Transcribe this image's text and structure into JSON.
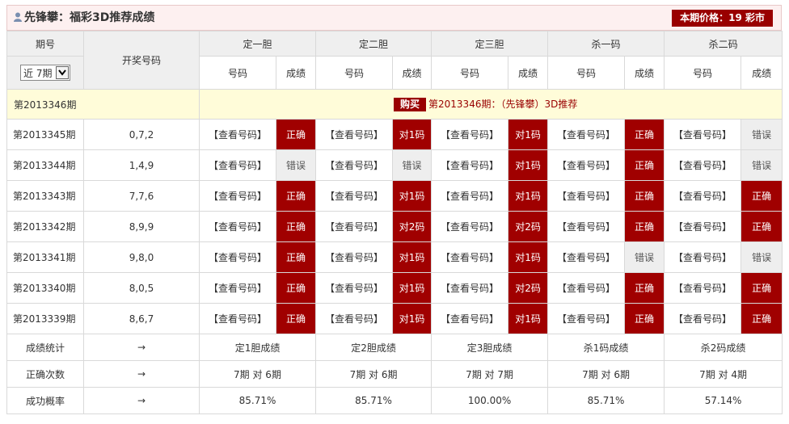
{
  "header": {
    "title": "先锋攀：福彩3D推荐成绩",
    "price": "本期价格：19 彩市"
  },
  "columns": {
    "period": "期号",
    "draw": "开奖号码",
    "groups": [
      "定一胆",
      "定二胆",
      "定三胆",
      "杀一码",
      "杀二码"
    ],
    "sub_code": "号码",
    "sub_result": "成绩"
  },
  "filter": {
    "selected": "近 7期"
  },
  "current": {
    "period": "第2013346期",
    "buy_label": "购买",
    "text": "第2013346期：（先锋攀）3D推荐"
  },
  "view_label": "【查看号码】",
  "rows": [
    {
      "period": "第2013345期",
      "draw": "0,7,2",
      "results": [
        "正确",
        "对1码",
        "对1码",
        "正确",
        "错误"
      ]
    },
    {
      "period": "第2013344期",
      "draw": "1,4,9",
      "results": [
        "错误",
        "错误",
        "对1码",
        "正确",
        "错误"
      ]
    },
    {
      "period": "第2013343期",
      "draw": "7,7,6",
      "results": [
        "正确",
        "对1码",
        "对1码",
        "正确",
        "正确"
      ]
    },
    {
      "period": "第2013342期",
      "draw": "8,9,9",
      "results": [
        "正确",
        "对2码",
        "对2码",
        "正确",
        "正确"
      ]
    },
    {
      "period": "第2013341期",
      "draw": "9,8,0",
      "results": [
        "正确",
        "对1码",
        "对1码",
        "错误",
        "错误"
      ]
    },
    {
      "period": "第2013340期",
      "draw": "8,0,5",
      "results": [
        "正确",
        "对1码",
        "对2码",
        "正确",
        "正确"
      ]
    },
    {
      "period": "第2013339期",
      "draw": "8,6,7",
      "results": [
        "正确",
        "对1码",
        "对1码",
        "正确",
        "正确"
      ]
    }
  ],
  "stats": [
    {
      "label": "成绩统计",
      "arrow": "→",
      "values": [
        "定1胆成绩",
        "定2胆成绩",
        "定3胆成绩",
        "杀1码成绩",
        "杀2码成绩"
      ]
    },
    {
      "label": "正确次数",
      "arrow": "→",
      "values": [
        "7期 对 6期",
        "7期 对 6期",
        "7期 对 7期",
        "7期 对 6期",
        "7期 对 4期"
      ]
    },
    {
      "label": "成功概率",
      "arrow": "→",
      "values": [
        "85.71%",
        "85.71%",
        "100.00%",
        "85.71%",
        "57.14%"
      ]
    }
  ],
  "colors": {
    "accent": "#a00000",
    "error_bg": "#eeeeee"
  }
}
